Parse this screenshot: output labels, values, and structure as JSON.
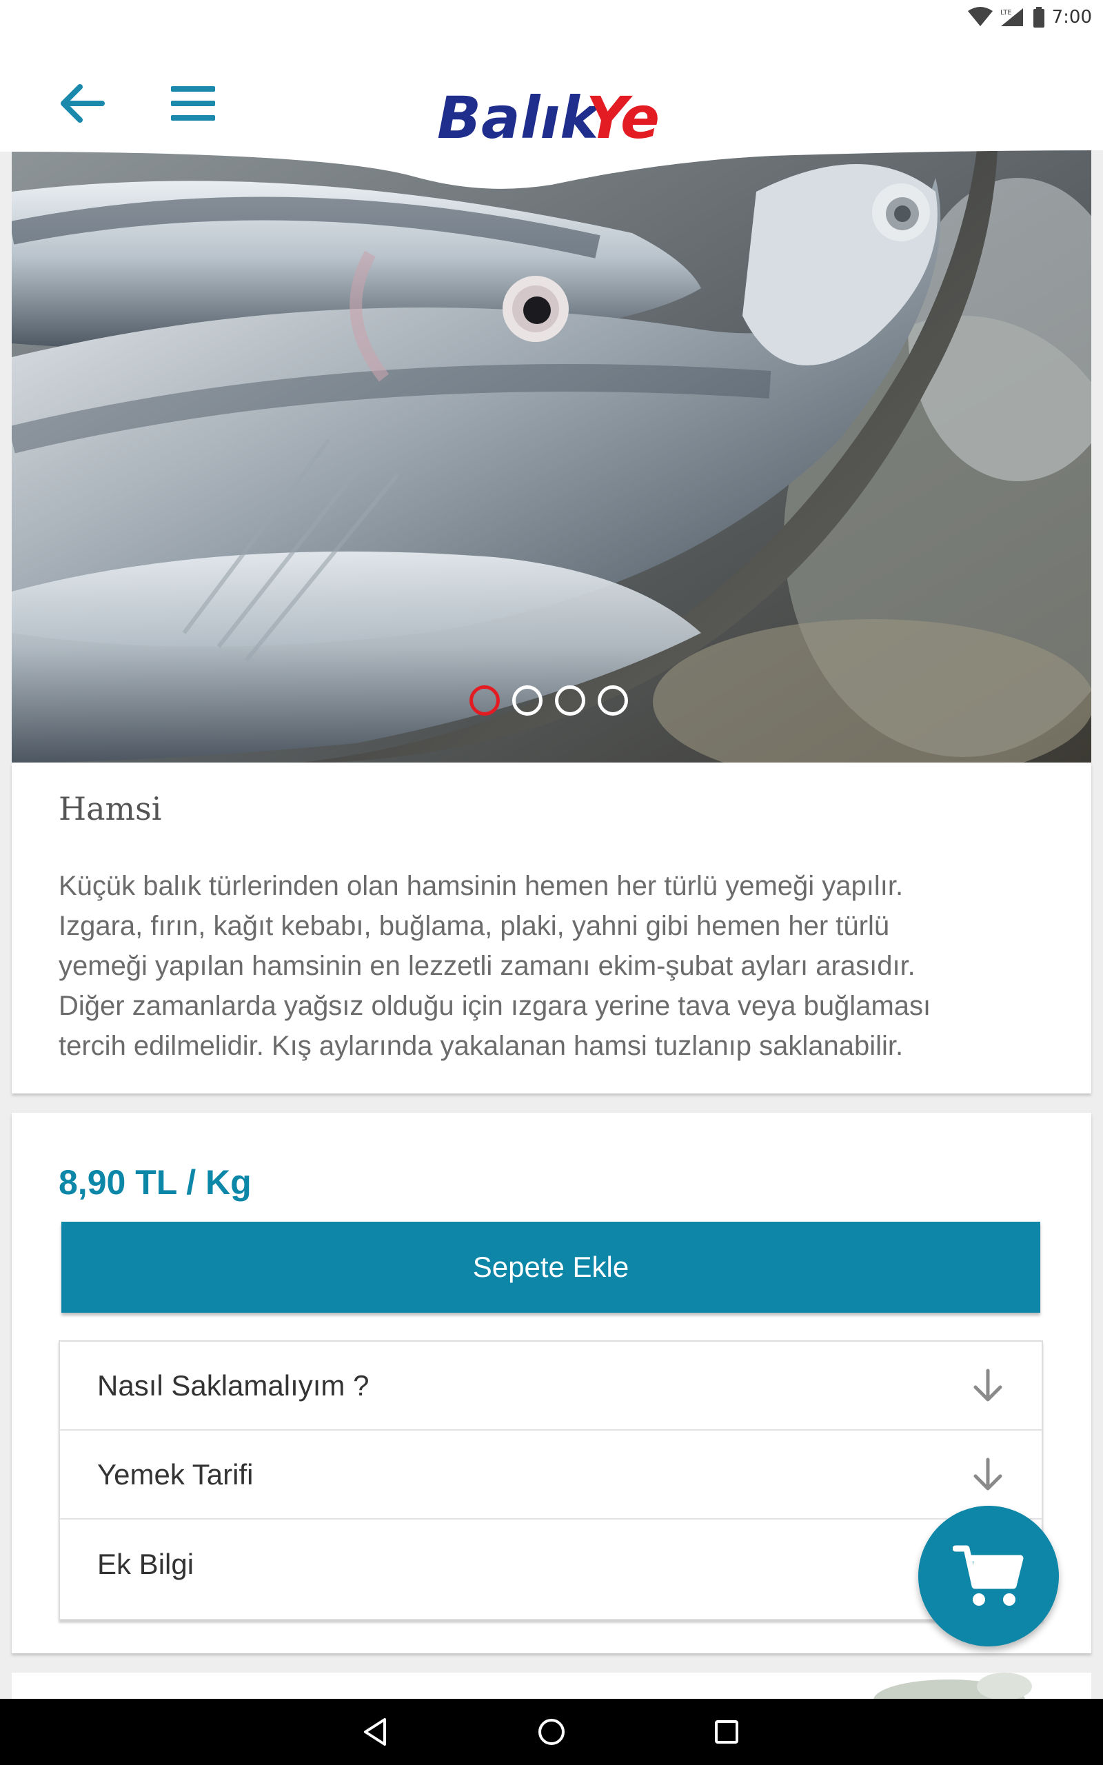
{
  "status_bar": {
    "time": "7:00",
    "network": "LTE",
    "icons": [
      "wifi-icon",
      "signal-icon",
      "battery-icon"
    ]
  },
  "header": {
    "back_icon": "arrow-left-icon",
    "menu_icon": "hamburger-menu-icon",
    "logo_text_1": "Balık",
    "logo_text_2": "Ye"
  },
  "hero": {
    "image_alt": "Hamsi",
    "slide_count": 4,
    "active_slide": 1
  },
  "product": {
    "title": "Hamsi",
    "description_lines": [
      "Küçük balık türlerinden olan hamsinin hemen her türlü yemeği yapılır.",
      "Izgara, fırın, kağıt kebabı, buğlama, plaki, yahni gibi hemen her türlü",
      "yemeği yapılan hamsinin en lezzetli zamanı ekim-şubat ayları arasıdır.",
      "Diğer zamanlarda yağsız olduğu için ızgara yerine tava veya buğlaması",
      "tercih edilmelidir. Kış aylarında yakalanan hamsi tuzlanıp saklanabilir."
    ],
    "price": "8,90 TL / Kg",
    "add_to_cart": "Sepete Ekle"
  },
  "accordion": [
    {
      "label": "Nasıl Saklamalıyım ?",
      "icon": "arrow-down-icon"
    },
    {
      "label": "Yemek Tarifi",
      "icon": "arrow-down-icon"
    },
    {
      "label": "Ek Bilgi",
      "icon": "arrow-down-icon"
    }
  ],
  "fab": {
    "icon": "shopping-cart-icon"
  },
  "colors": {
    "accent": "#0d86a8",
    "logo_blue": "#1f2d8c",
    "logo_red": "#e31b23",
    "active_dot": "#e31b23"
  }
}
